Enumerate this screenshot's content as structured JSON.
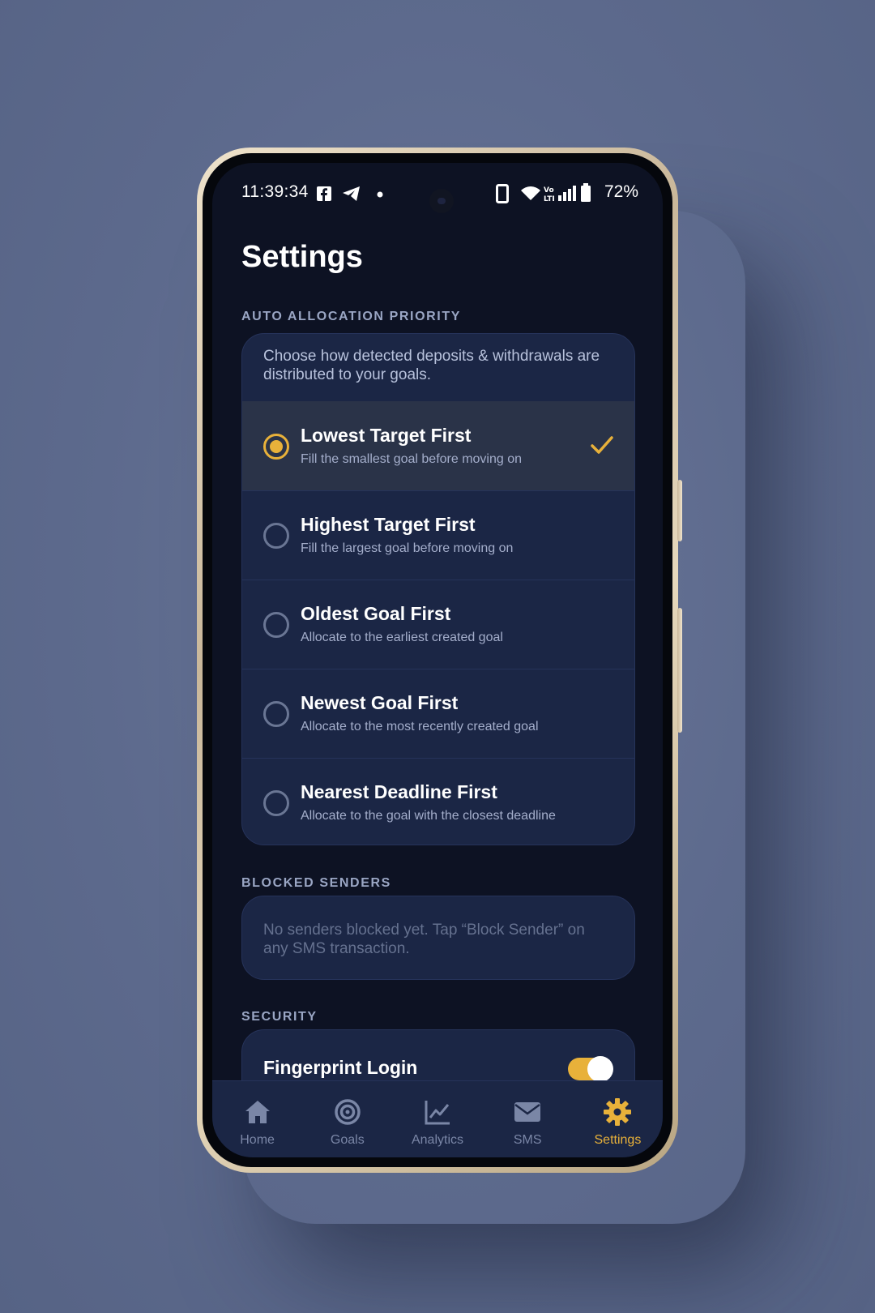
{
  "status_bar": {
    "time": "11:39:34",
    "battery": "72%",
    "icons": [
      "facebook-icon",
      "telegram-icon",
      "dot-icon",
      "phone-icon",
      "wifi-icon",
      "volte-icon",
      "signal-icon",
      "battery-icon"
    ]
  },
  "page": {
    "title": "Settings"
  },
  "auto_allocation": {
    "label": "AUTO ALLOCATION PRIORITY",
    "description": "Choose how detected deposits & withdrawals are distributed to your goals.",
    "selected_index": 0,
    "options": [
      {
        "title": "Lowest Target First",
        "subtitle": "Fill the smallest goal before moving on"
      },
      {
        "title": "Highest Target First",
        "subtitle": "Fill the largest goal before moving on"
      },
      {
        "title": "Oldest Goal First",
        "subtitle": "Allocate to the earliest created goal"
      },
      {
        "title": "Newest Goal First",
        "subtitle": "Allocate to the most recently created goal"
      },
      {
        "title": "Nearest Deadline First",
        "subtitle": "Allocate to the goal with the closest deadline"
      }
    ]
  },
  "blocked_senders": {
    "label": "BLOCKED SENDERS",
    "empty_text": "No senders blocked yet. Tap “Block Sender” on any SMS transaction."
  },
  "security": {
    "label": "SECURITY",
    "fingerprint_label": "Fingerprint Login",
    "fingerprint_enabled": true
  },
  "nav": {
    "items": [
      {
        "label": "Home",
        "icon": "home-icon"
      },
      {
        "label": "Goals",
        "icon": "target-icon"
      },
      {
        "label": "Analytics",
        "icon": "chart-icon"
      },
      {
        "label": "SMS",
        "icon": "envelope-icon"
      },
      {
        "label": "Settings",
        "icon": "gear-icon"
      }
    ],
    "active_index": 4
  },
  "colors": {
    "accent": "#e8b13a",
    "background": "#0d1223",
    "card": "#1b2645",
    "selected_row": "#2a3348"
  }
}
